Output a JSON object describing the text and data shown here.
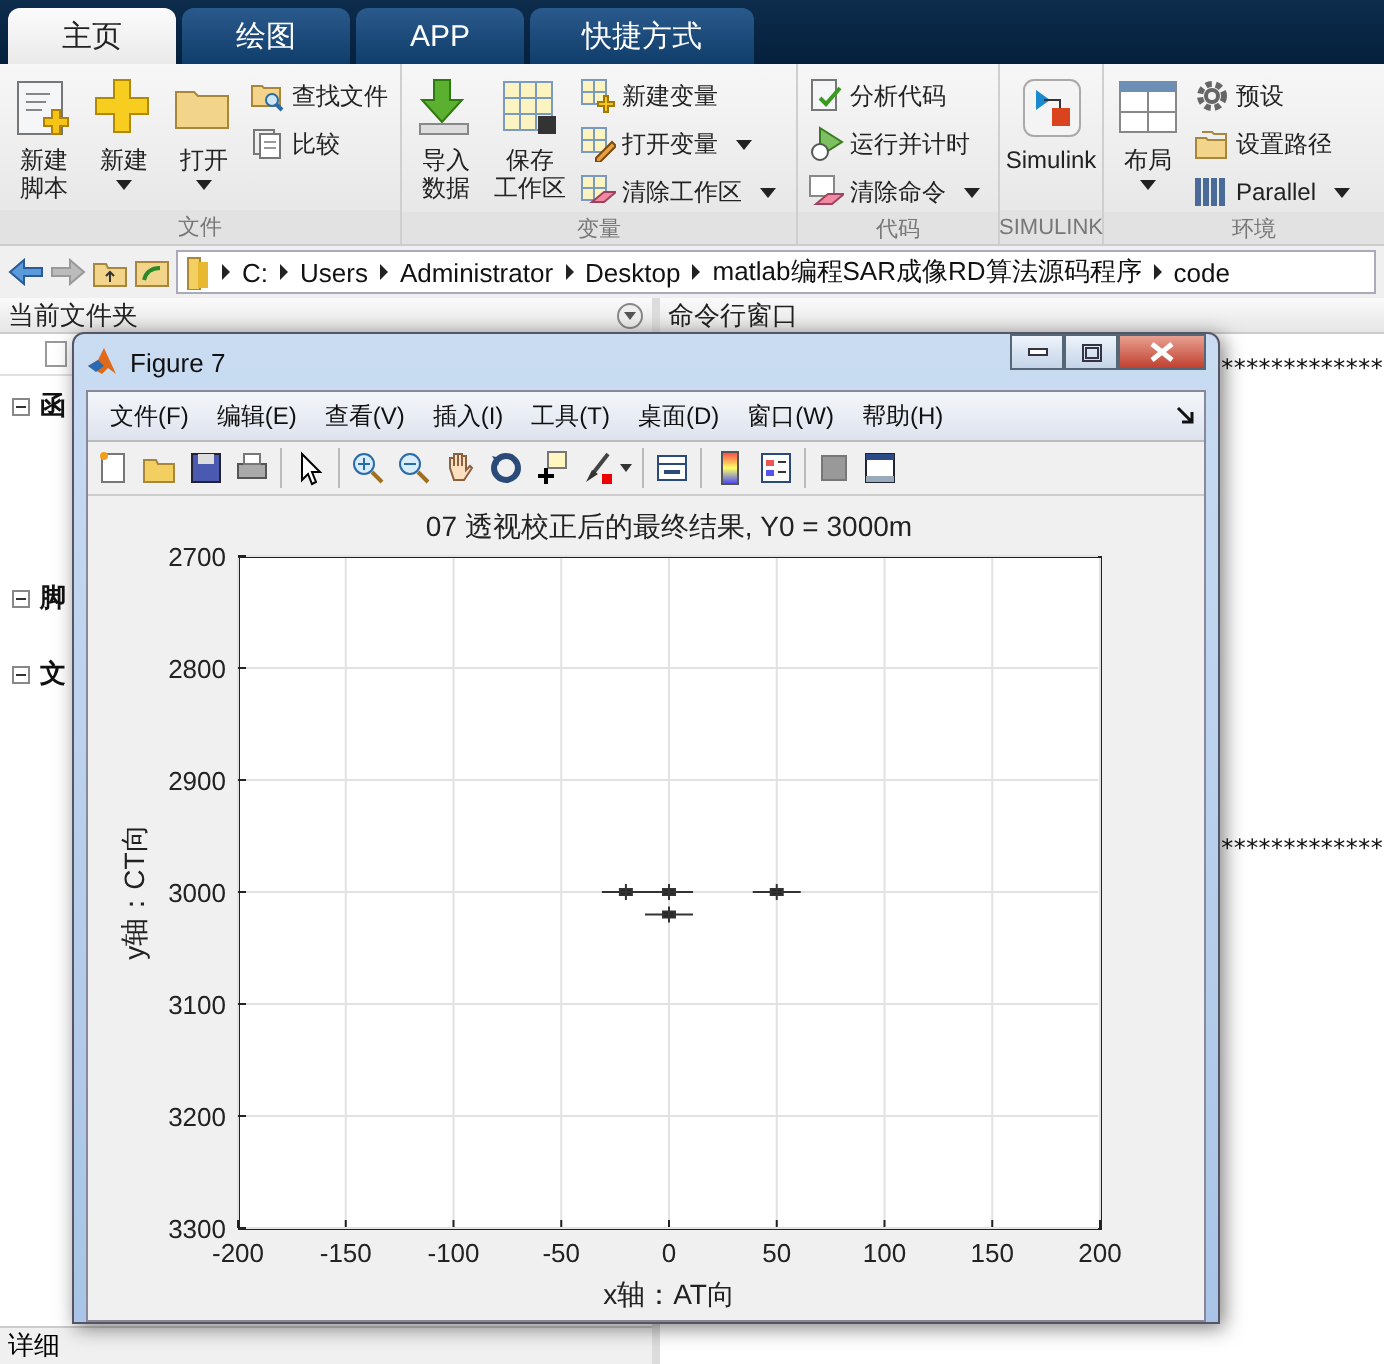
{
  "ribbon_tabs": [
    {
      "label": "主页",
      "selected": true
    },
    {
      "label": "绘图",
      "selected": false
    },
    {
      "label": "APP",
      "selected": false
    },
    {
      "label": "快捷方式",
      "selected": false
    }
  ],
  "ribbon_groups": [
    {
      "title": "文件",
      "items": [
        {
          "kind": "large",
          "lines": [
            "新建",
            "脚本"
          ],
          "has_menu": false
        },
        {
          "kind": "large",
          "lines": [
            "新建"
          ],
          "has_menu": true
        },
        {
          "kind": "large",
          "lines": [
            "打开"
          ],
          "has_menu": true
        },
        {
          "kind": "stack",
          "entries": [
            {
              "label": "查找文件",
              "has_menu": false
            },
            {
              "label": "比较",
              "has_menu": false
            }
          ]
        }
      ]
    },
    {
      "title": "变量",
      "items": [
        {
          "kind": "large",
          "lines": [
            "导入",
            "数据"
          ],
          "has_menu": false
        },
        {
          "kind": "large",
          "lines": [
            "保存",
            "工作区"
          ],
          "has_menu": false
        },
        {
          "kind": "stack",
          "entries": [
            {
              "label": "新建变量",
              "has_menu": false
            },
            {
              "label": "打开变量",
              "has_menu": true
            },
            {
              "label": "清除工作区",
              "has_menu": true
            }
          ]
        }
      ]
    },
    {
      "title": "代码",
      "items": [
        {
          "kind": "stack",
          "entries": [
            {
              "label": "分析代码",
              "has_menu": false
            },
            {
              "label": "运行并计时",
              "has_menu": false
            },
            {
              "label": "清除命令",
              "has_menu": true
            }
          ]
        }
      ]
    },
    {
      "title": "SIMULINK",
      "items": [
        {
          "kind": "large",
          "lines": [
            "Simulink"
          ],
          "has_menu": false
        }
      ]
    },
    {
      "title": "环境",
      "items": [
        {
          "kind": "large",
          "lines": [
            "布局"
          ],
          "has_menu": true
        },
        {
          "kind": "stack",
          "entries": [
            {
              "label": "预设",
              "has_menu": false
            },
            {
              "label": "设置路径",
              "has_menu": false
            },
            {
              "label": "Parallel",
              "has_menu": true
            }
          ]
        }
      ]
    }
  ],
  "address_bar": {
    "path": [
      "C:",
      "Users",
      "Administrator",
      "Desktop",
      "matlab编程SAR成像RD算法源码程序",
      "code"
    ]
  },
  "current_folder": {
    "title": "当前文件夹",
    "sections": [
      {
        "label": "函",
        "expanded": true
      },
      {
        "label": "脚",
        "expanded": true
      },
      {
        "label": "文",
        "expanded": true
      }
    ],
    "details_label": "详细"
  },
  "command_window": {
    "title": "命令行窗口",
    "lines": [
      "*************",
      "*************"
    ]
  },
  "figure": {
    "title": "Figure 7",
    "menu": [
      "文件(F)",
      "编辑(E)",
      "查看(V)",
      "插入(I)",
      "工具(T)",
      "桌面(D)",
      "窗口(W)",
      "帮助(H)"
    ],
    "chart_data": {
      "type": "scatter",
      "grid": true,
      "title": "07 透视校正后的最终结果, Y0 = 3000m",
      "xlabel": "x轴：AT向",
      "ylabel": "y轴：CT向",
      "x": [
        -20,
        0,
        0,
        50
      ],
      "values": [
        3000,
        3000,
        3020,
        3000
      ],
      "xlim": [
        -200,
        200
      ],
      "ylim": [
        3300,
        2700
      ],
      "xticks": [
        -200,
        -150,
        -100,
        -50,
        0,
        50,
        100,
        150,
        200
      ],
      "yticks": [
        2700,
        2800,
        2900,
        3000,
        3100,
        3200,
        3300
      ]
    }
  }
}
